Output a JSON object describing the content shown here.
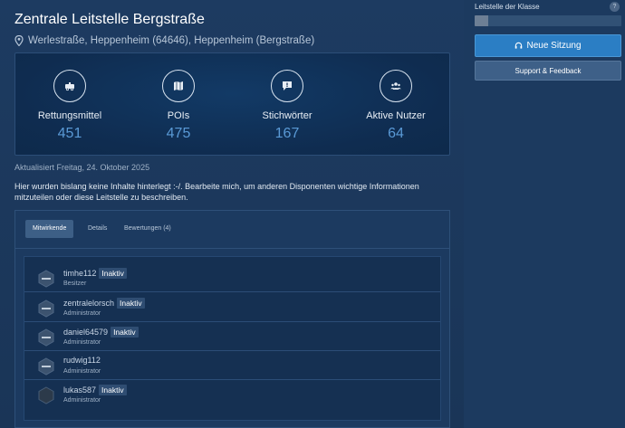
{
  "page": {
    "title": "Zentrale Leitstelle Bergstraße",
    "address": "Werlestraße, Heppenheim (64646), Heppenheim (Bergstraße)"
  },
  "stats": [
    {
      "label": "Rettungsmittel",
      "value": "451",
      "icon": "ambulance-icon"
    },
    {
      "label": "POIs",
      "value": "475",
      "icon": "map-icon"
    },
    {
      "label": "Stichwörter",
      "value": "167",
      "icon": "speech-bubble-icon"
    },
    {
      "label": "Aktive Nutzer",
      "value": "64",
      "icon": "users-icon"
    }
  ],
  "updated": "Aktualisiert Freitag, 24. Oktober 2025",
  "description": "Hier wurden bislang keine Inhalte hinterlegt :-/. Bearbeite mich, um anderen Disponenten wichtige Informationen mitzuteilen oder diese Leitstelle zu beschreiben.",
  "tabs": [
    {
      "label": "Mitwirkende",
      "active": true
    },
    {
      "label": "Details",
      "active": false
    },
    {
      "label": "Bewertungen (4)",
      "active": false
    }
  ],
  "members": [
    {
      "name": "timhe112",
      "badge": "Inaktiv",
      "role": "Besitzer"
    },
    {
      "name": "zentralelorsch",
      "badge": "Inaktiv",
      "role": "Administrator"
    },
    {
      "name": "daniel64579",
      "badge": "Inaktiv",
      "role": "Administrator"
    },
    {
      "name": "rudwig112",
      "badge": "",
      "role": "Administrator"
    },
    {
      "name": "lukas587",
      "badge": "Inaktiv",
      "role": "Administrator"
    }
  ],
  "sidebar": {
    "class_label": "Leitstelle der Klasse",
    "help": "?",
    "progress_fraction": 0.09,
    "new_session_label": "Neue Sitzung",
    "support_label": "Support & Feedback"
  },
  "colors": {
    "accent": "#2b7ec4",
    "stat_value": "#5a9ad6",
    "background": "#1f3d63"
  }
}
